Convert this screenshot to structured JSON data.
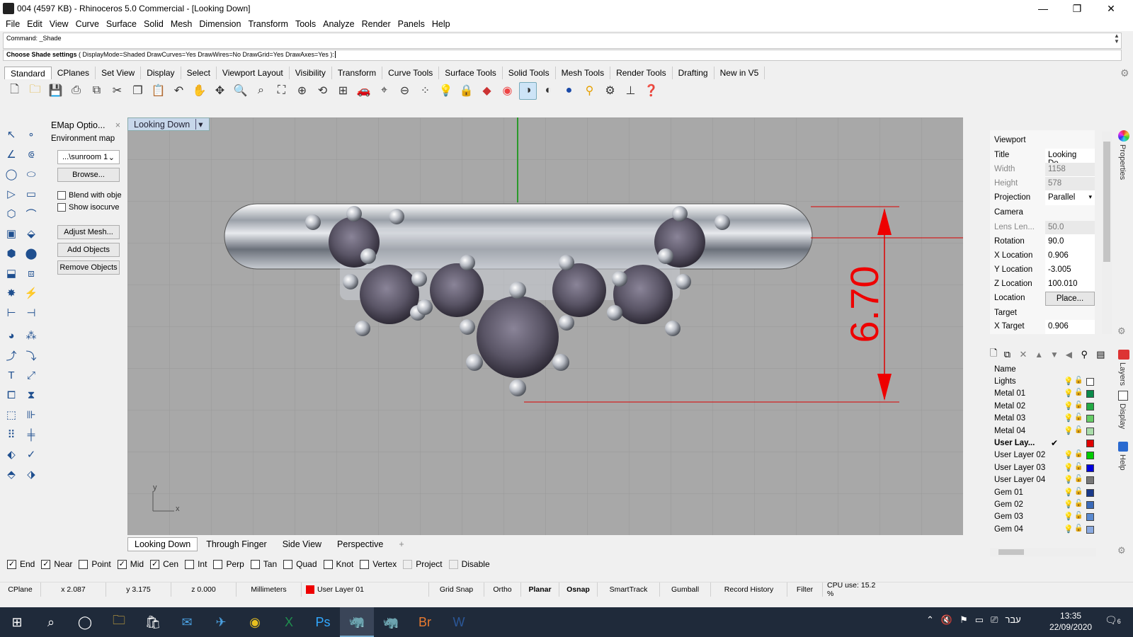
{
  "window": {
    "title": "004 (4597 KB) - Rhinoceros 5.0 Commercial - [Looking Down]",
    "minimize": "—",
    "restore": "❐",
    "close": "✕"
  },
  "menu": [
    "File",
    "Edit",
    "View",
    "Curve",
    "Surface",
    "Solid",
    "Mesh",
    "Dimension",
    "Transform",
    "Tools",
    "Analyze",
    "Render",
    "Panels",
    "Help"
  ],
  "command": {
    "history": "Command: _Shade",
    "prompt_bold": "Choose Shade settings",
    "prompt_rest": " ( DisplayMode=Shaded  DrawCurves=Yes  DrawWires=No  DrawGrid=Yes  DrawAxes=Yes ):"
  },
  "toolbar_tabs": [
    "Standard",
    "CPlanes",
    "Set View",
    "Display",
    "Select",
    "Viewport Layout",
    "Visibility",
    "Transform",
    "Curve Tools",
    "Surface Tools",
    "Solid Tools",
    "Mesh Tools",
    "Render Tools",
    "Drafting",
    "New in V5"
  ],
  "emap": {
    "panel_title": "EMap Optio...",
    "section": "Environment map",
    "map_value": "...\\sunroom 1",
    "browse": "Browse...",
    "blend": "Blend with obje",
    "show_iso": "Show isocurve",
    "adjust": "Adjust Mesh...",
    "add": "Add Objects",
    "remove": "Remove Objects"
  },
  "viewport": {
    "name": "Looking Down",
    "dimension_text": "6.70",
    "axis_y": "y",
    "axis_x": "x"
  },
  "view_tabs": [
    "Looking Down",
    "Through Finger",
    "Side View",
    "Perspective",
    "+"
  ],
  "osnaps": [
    {
      "label": "End",
      "checked": true
    },
    {
      "label": "Near",
      "checked": true
    },
    {
      "label": "Point",
      "checked": false
    },
    {
      "label": "Mid",
      "checked": true
    },
    {
      "label": "Cen",
      "checked": true
    },
    {
      "label": "Int",
      "checked": false
    },
    {
      "label": "Perp",
      "checked": false
    },
    {
      "label": "Tan",
      "checked": false
    },
    {
      "label": "Quad",
      "checked": false
    },
    {
      "label": "Knot",
      "checked": false
    },
    {
      "label": "Vertex",
      "checked": false
    },
    {
      "label": "Project",
      "checked": false
    },
    {
      "label": "Disable",
      "checked": false
    }
  ],
  "status": {
    "cplane": "CPlane",
    "x": "x 2.087",
    "y": "y 3.175",
    "z": "z 0.000",
    "units": "Millimeters",
    "layer": "User Layer 01",
    "layer_color": "#e00000",
    "grid_snap": "Grid Snap",
    "ortho": "Ortho",
    "planar": "Planar",
    "osnap": "Osnap",
    "smarttrack": "SmartTrack",
    "gumball": "Gumball",
    "record_history": "Record History",
    "filter": "Filter",
    "cpu": "CPU use: 15.2 %"
  },
  "properties": {
    "section_viewport": "Viewport",
    "title_k": "Title",
    "title_v": "Looking Do...",
    "width_k": "Width",
    "width_v": "1158",
    "height_k": "Height",
    "height_v": "578",
    "projection_k": "Projection",
    "projection_v": "Parallel",
    "section_camera": "Camera",
    "lens_k": "Lens Len...",
    "lens_v": "50.0",
    "rotation_k": "Rotation",
    "rotation_v": "90.0",
    "xloc_k": "X Location",
    "xloc_v": "0.906",
    "yloc_k": "Y Location",
    "yloc_v": "-3.005",
    "zloc_k": "Z Location",
    "zloc_v": "100.010",
    "loc_k": "Location",
    "loc_v": "Place...",
    "section_target": "Target",
    "xtarget_k": "X Target",
    "xtarget_v": "0.906"
  },
  "layers": {
    "header": "Name",
    "rows": [
      {
        "name": "Lights",
        "color": "#ffffff",
        "current": false
      },
      {
        "name": "Metal 01",
        "color": "#0a8a4a",
        "current": false
      },
      {
        "name": "Metal 02",
        "color": "#22aa44",
        "current": false
      },
      {
        "name": "Metal 03",
        "color": "#66cc66",
        "current": false
      },
      {
        "name": "Metal 04",
        "color": "#aaddaa",
        "current": false
      },
      {
        "name": "User Lay...",
        "color": "#e00000",
        "current": true
      },
      {
        "name": "User Layer 02",
        "color": "#00cc00",
        "current": false
      },
      {
        "name": "User Layer 03",
        "color": "#0000dd",
        "current": false
      },
      {
        "name": "User Layer 04",
        "color": "#777777",
        "current": false
      },
      {
        "name": "Gem 01",
        "color": "#1a3a8a",
        "current": false
      },
      {
        "name": "Gem 02",
        "color": "#3a6ab8",
        "current": false
      },
      {
        "name": "Gem 03",
        "color": "#5a8ad0",
        "current": false
      },
      {
        "name": "Gem 04",
        "color": "#8aaae0",
        "current": false
      }
    ]
  },
  "side_tabs": [
    "Properties",
    "Layers",
    "Display",
    "Help"
  ],
  "clock": {
    "time": "13:35",
    "date": "22/09/2020",
    "lang": "עבר",
    "notif": "6"
  }
}
